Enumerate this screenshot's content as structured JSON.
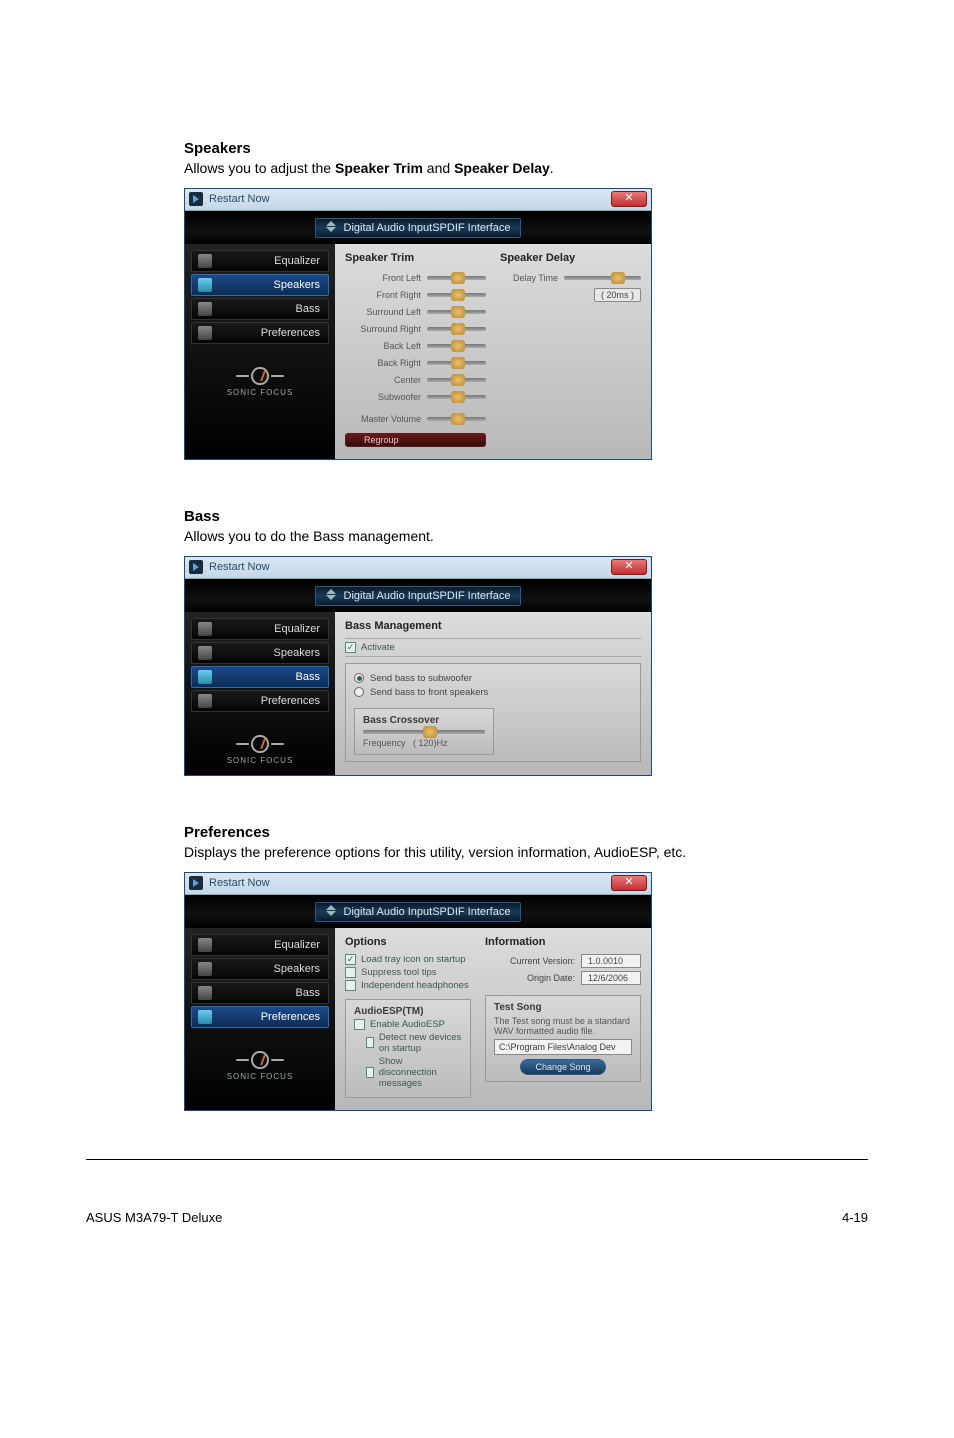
{
  "sections": {
    "speakers": {
      "heading": "Speakers",
      "desc_pre": "Allows you to adjust the ",
      "desc_b1": "Speaker Trim",
      "desc_mid": " and ",
      "desc_b2": "Speaker Delay",
      "desc_post": "."
    },
    "bass": {
      "heading": "Bass",
      "desc": "Allows you to do the Bass management."
    },
    "prefs": {
      "heading": "Preferences",
      "desc": "Displays the preference options for this utility, version information, AudioESP, etc."
    }
  },
  "window": {
    "title": "Restart Now",
    "close": "✕",
    "digital_label": "Digital Audio InputSPDIF Interface",
    "logo_text": "SONIC FOCUS"
  },
  "sidebar": {
    "items": [
      {
        "label": "Equalizer"
      },
      {
        "label": "Speakers"
      },
      {
        "label": "Bass"
      },
      {
        "label": "Preferences"
      }
    ]
  },
  "speakers_panel": {
    "trim_title": "Speaker Trim",
    "delay_title": "Speaker Delay",
    "delay_row_label": "Delay Time",
    "delay_badge": "( 20ms )",
    "sliders": [
      "Front Left",
      "Front Right",
      "Surround Left",
      "Surround Right",
      "Back Left",
      "Back Right",
      "Center",
      "Subwoofer",
      "Master Volume"
    ],
    "regroup": "Regroup"
  },
  "bass_panel": {
    "title": "Bass Management",
    "activate": "Activate",
    "opt_sub": "Send bass to subwoofer",
    "opt_front": "Send bass to front speakers",
    "crossover_title": "Bass Crossover",
    "freq_label": "Frequency",
    "freq_value": "( 120)Hz"
  },
  "prefs_panel": {
    "options_title": "Options",
    "opt_load": "Load tray icon on startup",
    "opt_suppress": "Suppress tool tips",
    "opt_headphones": "Independent headphones",
    "esp_title": "AudioESP(TM)",
    "esp_enable": "Enable AudioESP",
    "esp_detect": "Detect new devices on startup",
    "esp_show": "Show disconnection messages",
    "info_title": "Information",
    "ver_key": "Current Version:",
    "ver_val": "1.0.0010",
    "date_key": "Origin Date:",
    "date_val": "12/6/2006",
    "test_title": "Test Song",
    "test_desc": "The Test song must be a standard WAV formatted audio file.",
    "test_path": "C:\\Program Files\\Analog Dev",
    "change_song": "Change Song"
  },
  "footer": {
    "left": "ASUS M3A79-T Deluxe",
    "right": "4-19"
  }
}
